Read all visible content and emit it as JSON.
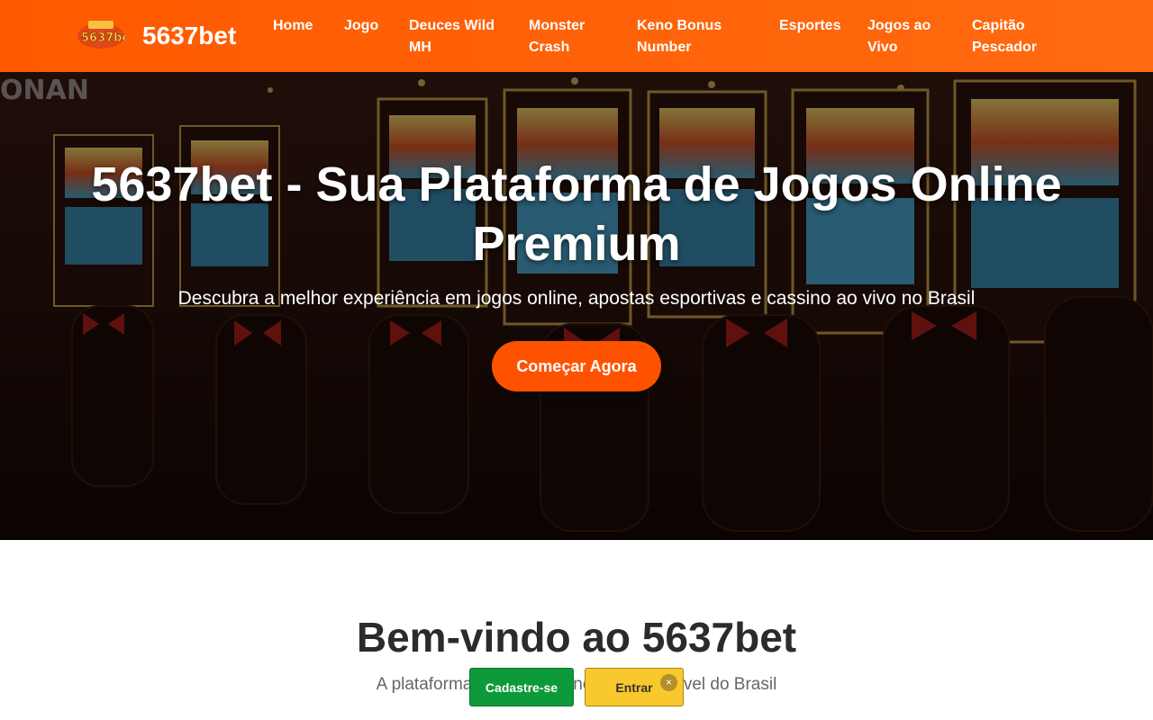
{
  "header": {
    "brand": "5637bet",
    "logo_text": "5637bet",
    "nav": [
      "Home",
      "Jogo",
      "Deuces Wild MH",
      "Monster Crash",
      "Keno Bonus Number",
      "Esportes",
      "Jogos ao Vivo",
      "Capitão Pescador"
    ]
  },
  "hero": {
    "title": "5637bet - Sua Plataforma de Jogos Online Premium",
    "subtitle": "Descubra a melhor experiência em jogos online, apostas esportivas e cassino ao vivo no Brasil",
    "cta": "Começar Agora",
    "background_sign": "ONAN"
  },
  "welcome": {
    "title": "Bem-vindo ao 5637bet",
    "subtitle": "A plataforma de jogos online mais confiável do Brasil"
  },
  "floating_bar": {
    "signup": "Cadastre-se",
    "login": "Entrar",
    "close": "×"
  },
  "colors": {
    "brand_orange": "#ff5a00",
    "signup_green": "#0d9a3a",
    "login_yellow": "#f9c82c"
  }
}
